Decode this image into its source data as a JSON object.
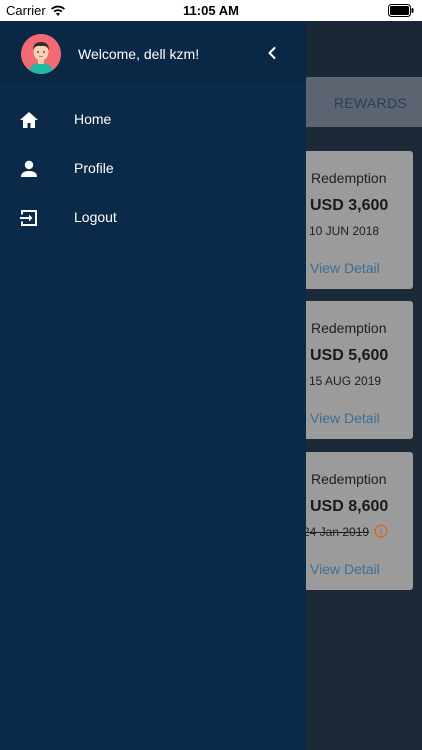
{
  "status_bar": {
    "carrier": "Carrier",
    "time": "11:05 AM"
  },
  "drawer": {
    "welcome_text": "Welcome, dell kzm!",
    "menu": [
      {
        "label": "Home",
        "icon": "home-icon"
      },
      {
        "label": "Profile",
        "icon": "person-icon"
      },
      {
        "label": "Logout",
        "icon": "logout-icon"
      }
    ]
  },
  "background": {
    "tab_rewards": "REWARDS",
    "cards": [
      {
        "type": "Redemption",
        "amount": "USD 3,600",
        "date": "10 JUN 2018",
        "link": "View Detail"
      },
      {
        "type": "Redemption",
        "amount": "USD 5,600",
        "date": "15 AUG 2019",
        "link": "View Detail"
      },
      {
        "type": "Redemption",
        "amount": "USD 8,600",
        "date": "24 Jan 2019",
        "link": "View Detail"
      }
    ]
  },
  "colors": {
    "drawer_bg": "#0b2a4a",
    "overlay_card": "#9b9b9b",
    "link": "#3c6f96",
    "info_icon": "#d2691e",
    "avatar_bg": "#f26a72"
  }
}
